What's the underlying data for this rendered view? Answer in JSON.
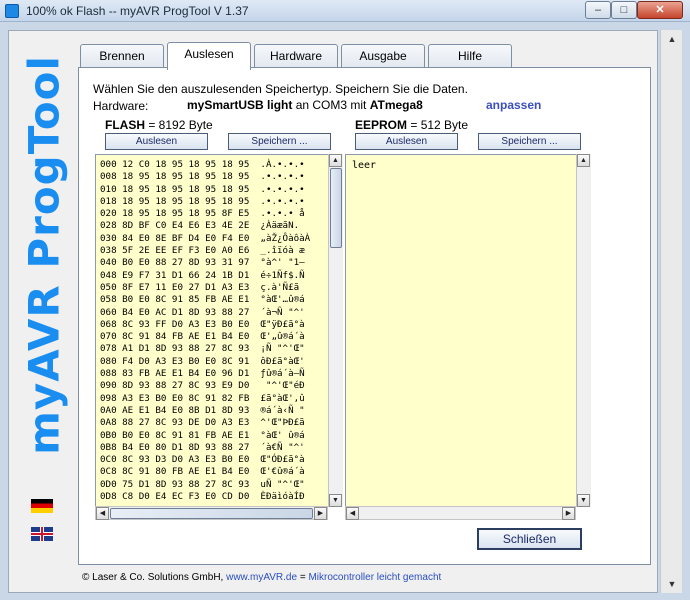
{
  "window": {
    "title": "100% ok Flash -- myAVR ProgTool V 1.37",
    "min_label": "–",
    "max_label": "□",
    "close_label": "✕"
  },
  "banner": {
    "text": "myAVR ProgTool",
    "color": "#1a8ef0"
  },
  "tabs": [
    {
      "label": "Brennen",
      "active": false
    },
    {
      "label": "Auslesen",
      "active": true
    },
    {
      "label": "Hardware",
      "active": false
    },
    {
      "label": "Ausgabe",
      "active": false
    },
    {
      "label": "Hilfe",
      "active": false
    }
  ],
  "main": {
    "description": "Wählen Sie den auszulesenden Speichertyp. Speichern Sie die Daten.",
    "hardware_label": "Hardware:",
    "hardware_programmer": "mySmartUSB light",
    "hardware_connector": " an COM3 mit ",
    "hardware_chip": "ATmega8",
    "adjust_link": "anpassen"
  },
  "flash": {
    "title_bold": "FLASH",
    "title_rest": " = 8192 Byte",
    "read_button": "Auslesen",
    "save_button": "Speichern ...",
    "rows": [
      "000 12 C0 18 95 18 95 18 95  .À.•.•.•",
      "008 18 95 18 95 18 95 18 95  .•.•.•.•",
      "010 18 95 18 95 18 95 18 95  .•.•.•.•",
      "018 18 95 18 95 18 95 18 95  .•.•.•.•",
      "020 18 95 18 95 18 95 8F E5  .•.•.• å",
      "028 8D BF C0 E4 E6 E3 4E 2E  ¿ÀäæãN.",
      "030 84 E0 8E BF D4 E0 F4 E0  „àŽ¿ÔàôàÀ",
      "038 5F 2E EE EF F3 E0 A0 E6  _.îïóà æ",
      "040 B0 E0 88 27 8D 93 31 97  °à^' \"1—",
      "048 E9 F7 31 D1 66 24 1B D1  é÷1Ñf$.Ñ",
      "050 8F E7 11 E0 27 D1 A3 E3  ç.à'Ñ£ã",
      "058 B0 E0 8C 91 85 FB AE E1  °àŒ'…û®á",
      "060 B4 E0 AC D1 8D 93 88 27  ´à¬Ñ \"^'",
      "068 8C 93 FF D0 A3 E3 B0 E0  Œ\"ÿÐ£ã°à",
      "070 8C 91 84 FB AE E1 B4 E0  Œ'„û®á´à",
      "078 A1 D1 8D 93 88 27 8C 93  ¡Ñ \"^'Œ\"",
      "080 F4 D0 A3 E3 B0 E0 8C 91  ôÐ£ã°àŒ'",
      "088 83 FB AE E1 B4 E0 96 D1  ƒû®á´à–Ñ",
      "090 8D 93 88 27 8C 93 E9 D0   \"^'Œ\"éÐ",
      "098 A3 E3 B0 E0 8C 91 82 FB  £ã°àŒ',û",
      "0A0 AE E1 B4 E0 8B D1 8D 93  ®á´à‹Ñ \"",
      "0A8 88 27 8C 93 DE D0 A3 E3  ^'Œ\"ÞÐ£ã",
      "0B0 B0 E0 8C 91 81 FB AE E1  °àŒ' û®á",
      "0B8 B4 E0 80 D1 8D 93 88 27  ´à€Ñ \"^'",
      "0C0 8C 93 D3 D0 A3 E3 B0 E0  Œ\"ÓÐ£ã°à",
      "0C8 8C 91 80 FB AE E1 B4 E0  Œ'€û®á´à",
      "0D0 75 D1 8D 93 88 27 8C 93  uÑ \"^'Œ\"",
      "0D8 C8 D0 E4 EC F3 E0 CD D0  ÈÐäìóàÍÐ"
    ]
  },
  "eeprom": {
    "title_bold": "EEPROM",
    "title_rest": " = 512 Byte",
    "read_button": "Auslesen",
    "save_button": "Speichern ...",
    "content": "leer"
  },
  "close_button": "Schließen",
  "footer": {
    "copyright": "© Laser & Co. Solutions GmbH, ",
    "link": "www.myAVR.de",
    "separator": " = ",
    "tagline": "Mikrocontroller leicht gemacht"
  }
}
